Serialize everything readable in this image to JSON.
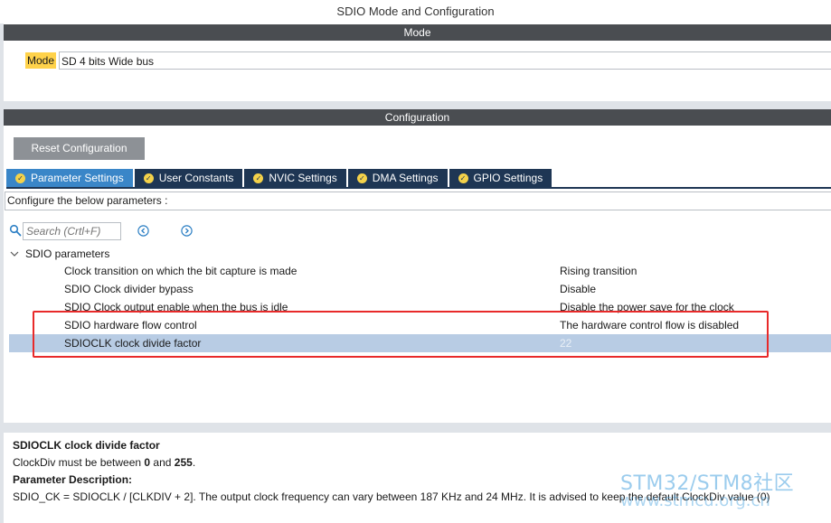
{
  "window": {
    "title": "SDIO Mode and Configuration"
  },
  "mode_section": {
    "header": "Mode",
    "label": "Mode",
    "value": "SD 4 bits Wide bus"
  },
  "config_section": {
    "header": "Configuration",
    "reset_button": "Reset Configuration",
    "tabs": [
      {
        "label": "Parameter Settings",
        "active": true
      },
      {
        "label": "User Constants",
        "active": false
      },
      {
        "label": "NVIC Settings",
        "active": false
      },
      {
        "label": "DMA Settings",
        "active": false
      },
      {
        "label": "GPIO Settings",
        "active": false
      }
    ],
    "configure_text": "Configure the below parameters :",
    "search": {
      "placeholder": "Search (Crtl+F)"
    },
    "group": {
      "label": "SDIO parameters"
    },
    "params": [
      {
        "name": "Clock transition on which the bit capture is made",
        "value": "Rising transition"
      },
      {
        "name": "SDIO Clock divider bypass",
        "value": "Disable"
      },
      {
        "name": "SDIO Clock output enable when the bus is idle",
        "value": "Disable the power save for the clock"
      },
      {
        "name": "SDIO hardware flow control",
        "value": "The hardware control flow is disabled"
      },
      {
        "name": "SDIOCLK clock divide factor",
        "value": "22"
      }
    ]
  },
  "description": {
    "title": "SDIOCLK clock divide factor",
    "range_prefix": "ClockDiv must be between ",
    "range_min": "0",
    "range_mid": " and ",
    "range_max": "255",
    "range_suffix": ".",
    "param_desc_heading": "Parameter Description:",
    "param_desc_text": "SDIO_CK = SDIOCLK / [CLKDIV + 2]. The output clock frequency can vary between 187 KHz and 24 MHz. It is advised to keep the default ClockDiv value (0)"
  },
  "watermark": {
    "line1": "STM32/STM8社区",
    "line2": "www.stmcu.org.cn"
  },
  "colors": {
    "header_bar": "#4a4d51",
    "tab_active": "#3a86c8",
    "tab_inactive": "#1e3654",
    "mode_label_bg": "#ffd24a",
    "highlight_box": "#e82a2a",
    "selected_row": "#b8cce4"
  }
}
